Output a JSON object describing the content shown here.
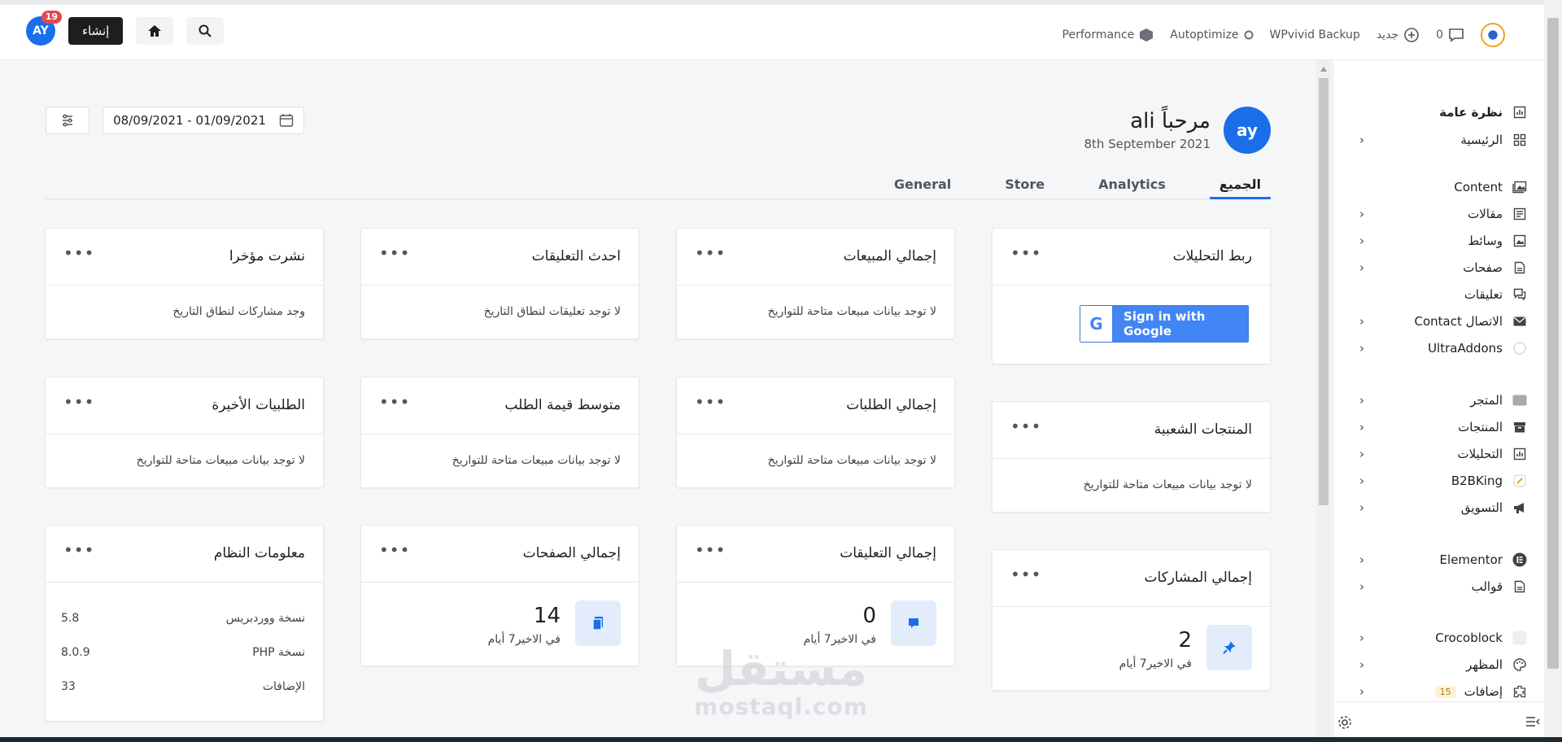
{
  "topbar": {
    "user_initials": "AY",
    "notifications": "19",
    "create_label": "إنشاء",
    "right_items": {
      "performance": "Performance",
      "autoptimize": "Autoptimize",
      "wpvivid": "WPvivid Backup",
      "new_label": "جديد",
      "comments_count": "0"
    }
  },
  "sidebar": {
    "items": [
      {
        "label": "نظرة عامة",
        "icon": "chart-icon"
      },
      {
        "label": "الرئيسية",
        "icon": "grid-icon"
      },
      {
        "label": "Content",
        "icon": "media-icon"
      },
      {
        "label": "مقالات",
        "icon": "post-icon"
      },
      {
        "label": "وسائط",
        "icon": "media-icon"
      },
      {
        "label": "صفحات",
        "icon": "page-icon"
      },
      {
        "label": "تعليقات",
        "icon": "comments-icon"
      },
      {
        "label": "الاتصال Contact",
        "icon": "mail-icon"
      },
      {
        "label": "UltraAddons",
        "icon": "ultra-icon"
      },
      {
        "label": "المتجر",
        "icon": "store-icon"
      },
      {
        "label": "المنتجات",
        "icon": "box-icon"
      },
      {
        "label": "التحليلات",
        "icon": "chart-icon"
      },
      {
        "label": "B2BKing",
        "icon": "b2b-icon"
      },
      {
        "label": "التسويق",
        "icon": "megaphone-icon"
      },
      {
        "label": "Elementor",
        "icon": "elementor-icon"
      },
      {
        "label": "قوالب",
        "icon": "page-icon"
      },
      {
        "label": "Crocoblock",
        "icon": "croco-icon"
      },
      {
        "label": "المظهر",
        "icon": "palette-icon"
      },
      {
        "label": "إضافات",
        "icon": "plugin-icon",
        "badge": "15"
      }
    ]
  },
  "header": {
    "avatar_initials": "ay",
    "greeting": "مرحباً ali",
    "date": "8th September 2021",
    "date_range": "08/09/2021 - 01/09/2021"
  },
  "tabs": [
    "الجميع",
    "Analytics",
    "Store",
    "General"
  ],
  "cards": {
    "analytics_connect": {
      "title": "ربط التحليلات",
      "google_label": "Sign in with Google"
    },
    "total_sales": {
      "title": "إجمالي المبيعات",
      "msg": "لا توجد بيانات مبيعات متاحة للتواريخ"
    },
    "latest_comments": {
      "title": "احدث التعليقات",
      "msg": "لا توجد تعليقات لنطاق التاريخ"
    },
    "recently_published": {
      "title": "نشرت مؤخرا",
      "msg": "وجد مشاركات لنطاق التاريخ"
    },
    "popular_products": {
      "title": "المنتجات الشعبية",
      "msg": "لا توجد بيانات مبيعات متاحة للتواريخ"
    },
    "total_orders": {
      "title": "إجمالي الطلبات",
      "msg": "لا توجد بيانات مبيعات متاحة للتواريخ"
    },
    "avg_order_value": {
      "title": "متوسط قيمة الطلب",
      "msg": "لا توجد بيانات مبيعات متاحة للتواريخ"
    },
    "recent_orders": {
      "title": "الطلبيات الأخيرة",
      "msg": "لا توجد بيانات مبيعات متاحة للتواريخ"
    },
    "total_posts": {
      "title": "إجمالي المشاركات",
      "value": "2",
      "sub": "في الاخير7 أيام"
    },
    "total_comments": {
      "title": "إجمالي التعليقات",
      "value": "0",
      "sub": "في الاخير7 أيام"
    },
    "total_pages": {
      "title": "إجمالي الصفحات",
      "value": "14",
      "sub": "في الاخير7 أيام"
    },
    "system_info": {
      "title": "معلومات النظام",
      "rows": [
        {
          "k": "نسخة ووردبريس",
          "v": "5.8"
        },
        {
          "k": "نسخة PHP",
          "v": "8.0.9"
        },
        {
          "k": "الإضافات",
          "v": "33"
        }
      ]
    }
  },
  "watermark": {
    "arabic": "مستقل",
    "latin": "mostaql.com"
  }
}
